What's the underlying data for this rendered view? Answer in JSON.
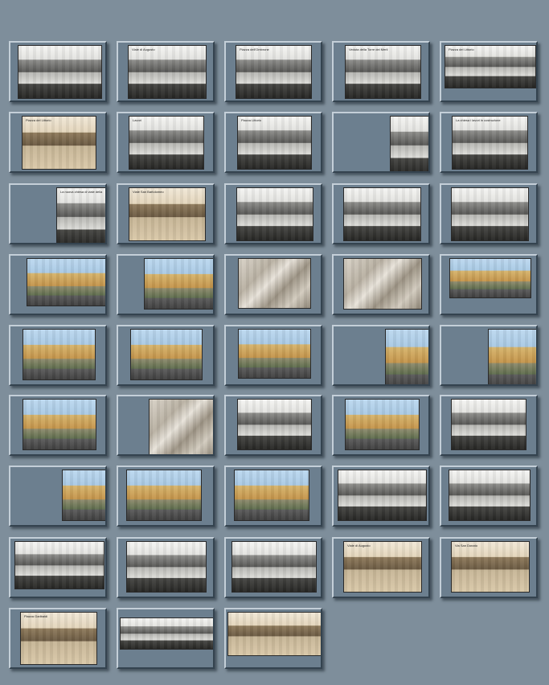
{
  "palette": {
    "background": "#7e8e9b",
    "frame": "#6c7f8f",
    "bevel_light": "#c4cfd8",
    "bevel_dark": "#34434f"
  },
  "thumbnails": [
    {
      "title": "",
      "tone": "bw"
    },
    {
      "title": "Viale di Augusto",
      "tone": "bw"
    },
    {
      "title": "Piazza dell'Ombrone",
      "tone": "bw"
    },
    {
      "title": "Veduta della Torre dei Merli",
      "tone": "bw"
    },
    {
      "title": "Piazza del Littorio",
      "tone": "bw"
    },
    {
      "title": "Piazza del Littorio",
      "tone": "sepia"
    },
    {
      "title": "Lavori",
      "tone": "bw"
    },
    {
      "title": "Piazza Littorio",
      "tone": "bw"
    },
    {
      "title": "",
      "tone": "bw"
    },
    {
      "title": "La chiesa i lavori in costruzione",
      "tone": "bw"
    },
    {
      "title": "La nuova chiesa di viale della Vittoria",
      "tone": "bw"
    },
    {
      "title": "Viale San Bartolomeo",
      "tone": "sepia"
    },
    {
      "title": "",
      "tone": "bw"
    },
    {
      "title": "",
      "tone": "bw"
    },
    {
      "title": "",
      "tone": "bw"
    },
    {
      "title": "",
      "tone": "color"
    },
    {
      "title": "",
      "tone": "color"
    },
    {
      "title": "",
      "tone": "stone"
    },
    {
      "title": "",
      "tone": "stone"
    },
    {
      "title": "",
      "tone": "color"
    },
    {
      "title": "",
      "tone": "color"
    },
    {
      "title": "",
      "tone": "color"
    },
    {
      "title": "",
      "tone": "color"
    },
    {
      "title": "",
      "tone": "color"
    },
    {
      "title": "",
      "tone": "color"
    },
    {
      "title": "",
      "tone": "color"
    },
    {
      "title": "",
      "tone": "stone"
    },
    {
      "title": "",
      "tone": "bw"
    },
    {
      "title": "",
      "tone": "color"
    },
    {
      "title": "",
      "tone": "bw"
    },
    {
      "title": "",
      "tone": "color"
    },
    {
      "title": "",
      "tone": "color"
    },
    {
      "title": "",
      "tone": "color"
    },
    {
      "title": "",
      "tone": "bw"
    },
    {
      "title": "",
      "tone": "bw"
    },
    {
      "title": "",
      "tone": "bw"
    },
    {
      "title": "",
      "tone": "bw"
    },
    {
      "title": "",
      "tone": "bw"
    },
    {
      "title": "Viale di Augusto",
      "tone": "sepia"
    },
    {
      "title": "Via San Donato",
      "tone": "sepia"
    },
    {
      "title": "Piazza Garibaldi",
      "tone": "sepia"
    },
    {
      "title": "",
      "tone": "bw"
    },
    {
      "title": "",
      "tone": "sepia"
    }
  ]
}
